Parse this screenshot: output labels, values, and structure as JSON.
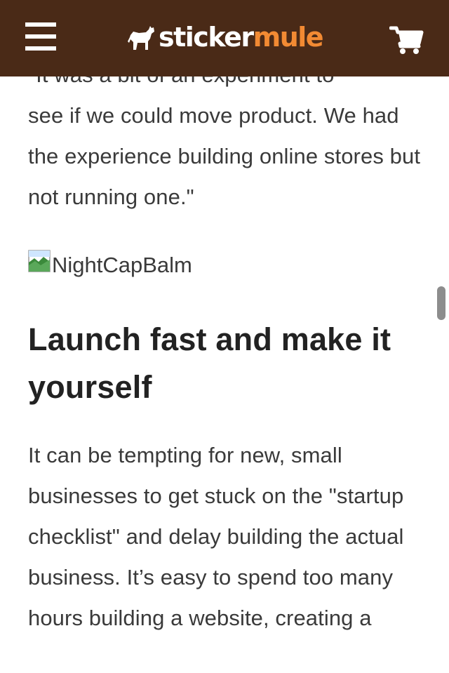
{
  "header": {
    "logo_word1": "sticker",
    "logo_word2": "mule",
    "menu_icon": "hamburger-menu-icon",
    "cart_icon": "shopping-cart-icon",
    "logo_icon": "mule-logo-icon"
  },
  "colors": {
    "header_bg": "#4a2a17",
    "logo_white": "#ffffff",
    "logo_orange": "#f28a33",
    "body_text": "#3a3a3a",
    "heading_text": "#222222"
  },
  "article": {
    "cutoff_line": "\"It was a bit of an experiment to",
    "paragraph_continued": "see if we could move product. We had the experience building online stores but not running one.\"",
    "image_alt": "NightCapBalm",
    "heading": "Launch fast and make it yourself",
    "paragraph": "It can be tempting for new, small businesses to get stuck on the \"startup checklist\" and delay building the actual business. It’s easy to spend too many hours building a website, creating a"
  }
}
